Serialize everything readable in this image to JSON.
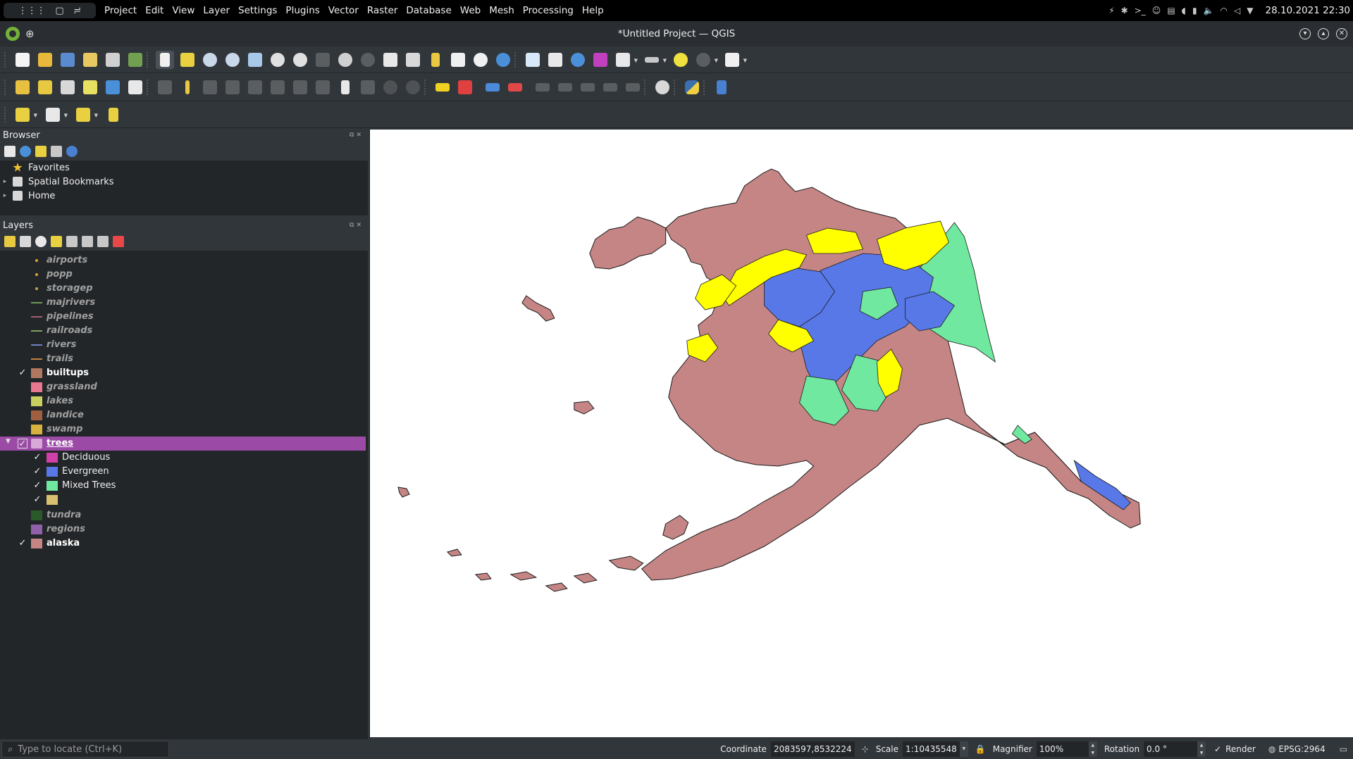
{
  "topbar": {
    "menu": [
      "Project",
      "Edit",
      "View",
      "Layer",
      "Settings",
      "Plugins",
      "Vector",
      "Raster",
      "Database",
      "Web",
      "Mesh",
      "Processing",
      "Help"
    ],
    "datetime": "28.10.2021  22:30"
  },
  "window": {
    "title": "*Untitled Project — QGIS"
  },
  "browser": {
    "title": "Browser",
    "items": [
      {
        "label": "Favorites",
        "icon": "star-icon"
      },
      {
        "label": "Spatial Bookmarks",
        "icon": "bookmark-icon"
      },
      {
        "label": "Home",
        "icon": "home-folder-icon"
      }
    ]
  },
  "layers": {
    "title": "Layers",
    "items": [
      {
        "name": "airports",
        "checked": false,
        "symbol": "point",
        "color": "#e0a030"
      },
      {
        "name": "popp",
        "checked": false,
        "symbol": "point",
        "color": "#e0a030"
      },
      {
        "name": "storagep",
        "checked": false,
        "symbol": "point",
        "color": "#c8a050"
      },
      {
        "name": "majrivers",
        "checked": false,
        "symbol": "line",
        "color": "#6a9a5a"
      },
      {
        "name": "pipelines",
        "checked": false,
        "symbol": "line",
        "color": "#a06070"
      },
      {
        "name": "railroads",
        "checked": false,
        "symbol": "line",
        "color": "#80a060"
      },
      {
        "name": "rivers",
        "checked": false,
        "symbol": "line",
        "color": "#7080c0"
      },
      {
        "name": "trails",
        "checked": false,
        "symbol": "line",
        "color": "#c08040"
      },
      {
        "name": "builtups",
        "checked": true,
        "symbol": "fill",
        "color": "#b07860"
      },
      {
        "name": "grassland",
        "checked": false,
        "symbol": "fill",
        "color": "#e87890"
      },
      {
        "name": "lakes",
        "checked": false,
        "symbol": "fill",
        "color": "#c8d060"
      },
      {
        "name": "landice",
        "checked": false,
        "symbol": "fill",
        "color": "#a06040"
      },
      {
        "name": "swamp",
        "checked": false,
        "symbol": "fill",
        "color": "#d8b040"
      }
    ],
    "group": {
      "name": "trees",
      "checked": true,
      "classes": [
        {
          "name": "Deciduous",
          "color": "#d040a8"
        },
        {
          "name": "Evergreen",
          "color": "#5878e8"
        },
        {
          "name": "Mixed Trees",
          "color": "#70e8a0"
        },
        {
          "name": "",
          "color": "#d8c070"
        }
      ]
    },
    "after": [
      {
        "name": "tundra",
        "checked": false,
        "symbol": "fill",
        "color": "#2a5a2a"
      },
      {
        "name": "regions",
        "checked": false,
        "symbol": "fill",
        "color": "#9060a8"
      },
      {
        "name": "alaska",
        "checked": true,
        "symbol": "fill",
        "color": "#c58585"
      }
    ]
  },
  "map": {
    "colors": {
      "land": "#c58585",
      "evergreen": "#5878e8",
      "mixed": "#70e8a0",
      "yellow": "#ffff00",
      "outline": "#1a1a1a"
    }
  },
  "status": {
    "locator_placeholder": "Type to locate (Ctrl+K)",
    "coordinate_label": "Coordinate",
    "coordinate_value": "2083597,8532224",
    "scale_label": "Scale",
    "scale_value": "1:10435548",
    "magnifier_label": "Magnifier",
    "magnifier_value": "100%",
    "rotation_label": "Rotation",
    "rotation_value": "0.0 °",
    "render_label": "Render",
    "crs": "EPSG:2964"
  }
}
